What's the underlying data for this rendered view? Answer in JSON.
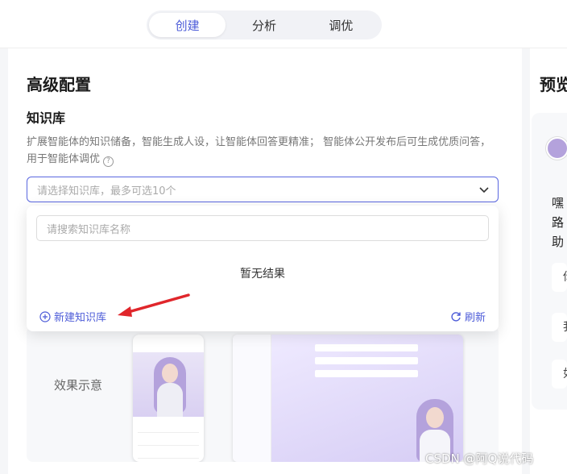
{
  "tabs": [
    {
      "label": "创建",
      "active": true
    },
    {
      "label": "分析",
      "active": false
    },
    {
      "label": "调优",
      "active": false
    }
  ],
  "section": {
    "title": "高级配置",
    "knowledge_title": "知识库",
    "description": "扩展智能体的知识储备，智能生成人设，让智能体回答更精准； 智能体公开发布后可生成优质问答，用于智能体调优"
  },
  "select": {
    "placeholder": "请选择知识库，最多可选10个"
  },
  "dropdown": {
    "search_placeholder": "请搜索知识库名称",
    "empty_text": "暂无结果",
    "new_label": "新建知识库",
    "refresh_label": "刷新"
  },
  "effect": {
    "label": "效果示意"
  },
  "preview": {
    "title": "预览",
    "text": "嘿路助",
    "suggestions": [
      "你",
      "我",
      "如"
    ]
  },
  "watermark": "CSDN @阿Q说代码",
  "colors": {
    "accent": "#4c5bd8",
    "arrow": "#e0262b"
  }
}
